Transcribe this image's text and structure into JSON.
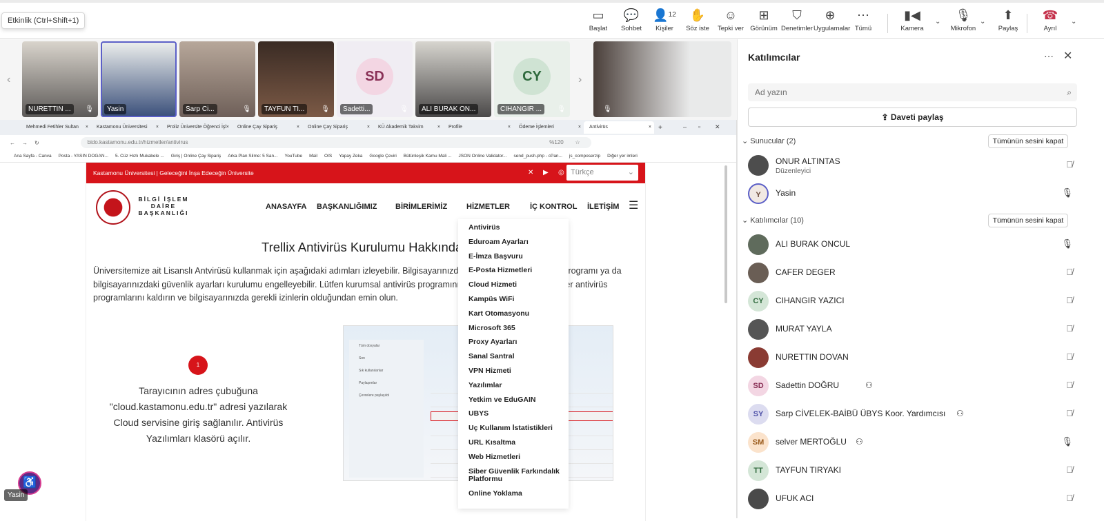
{
  "tooltip": "Etkinlik (Ctrl+Shift+1)",
  "toolbar": {
    "items": [
      {
        "label": "Başlat",
        "icon": "start-screen-icon"
      },
      {
        "label": "Sohbet",
        "icon": "chat-icon"
      },
      {
        "label": "Kişiler",
        "icon": "people-icon",
        "count": "12"
      },
      {
        "label": "Söz iste",
        "icon": "raise-hand-icon"
      },
      {
        "label": "Tepki ver",
        "icon": "reaction-icon"
      },
      {
        "label": "Görünüm",
        "icon": "view-icon"
      },
      {
        "label": "Denetimler",
        "icon": "controls-icon"
      },
      {
        "label": "Uygulamalar",
        "icon": "apps-icon"
      },
      {
        "label": "Tümü",
        "icon": "more-icon"
      },
      {
        "label": "Kamera",
        "icon": "camera-icon"
      },
      {
        "label": "Mikrofon",
        "icon": "mic-off-icon"
      },
      {
        "label": "Paylaş",
        "icon": "share-icon"
      },
      {
        "label": "Ayrıl",
        "icon": "hangup-icon"
      }
    ]
  },
  "gallery": {
    "tiles": [
      {
        "name": "NURETTIN ...",
        "type": "video"
      },
      {
        "name": "Yasin",
        "type": "video",
        "selected": true
      },
      {
        "name": "Sarp Ci...",
        "type": "video"
      },
      {
        "name": "TAYFUN TI...",
        "type": "video"
      },
      {
        "name": "Sadetti...",
        "type": "avatar",
        "initials": "SD"
      },
      {
        "name": "ALI BURAK ON...",
        "type": "video"
      },
      {
        "name": "CIHANGIR ...",
        "type": "avatar",
        "initials": "CY"
      }
    ]
  },
  "browser": {
    "tabs": [
      "Mehmedi Fetihler Sultan",
      "Kastamonu Üniversitesi",
      "Proliz Üniversite Öğrenci İşl",
      "Online Çay Sipariş",
      "Online Çay Sipariş",
      "KÜ Akademik Takvim",
      "Profile",
      "Ödeme İşlemleri",
      "Antivirüs"
    ],
    "url": "bido.kastamonu.edu.tr/hizmetler/antivirus",
    "zoom": "%120",
    "bookmarks": [
      "Ana Sayfa - Canva",
      "Posta - YASIN DOGAN...",
      "5. Cüz Hızlı Mukabele ...",
      "Giriş | Online Çay Sipariş",
      "Arka Plan Silme: 5 San...",
      "YouTube",
      "Mail",
      "OIS",
      "Yapay Zeka",
      "Google Çeviri",
      "Bütünleşik Kamu Mali ...",
      "JSON Online Validator...",
      "send_push.php - cPan...",
      "js_composerzip",
      "Diğer yer imleri"
    ]
  },
  "site": {
    "topbar_text": "Kastamonu Üniversitesi | Geleceğini İnşa Edeceğin Üniversite",
    "language": "Türkçe",
    "logo_text": "BİLGİ İŞLEM DAİRE BAŞKANLIĞI",
    "menu": [
      "ANASAYFA",
      "BAŞKANLIĞIMIZ",
      "BİRİMLERİMİZ",
      "HİZMETLER",
      "İÇ KONTROL",
      "İLETİŞİM"
    ],
    "title": "Trellix Antivirüs Kurulumu Hakkında",
    "paragraph": "Üniversitemize ait Lisanslı Antvirüsü kullanmak için aşağıdaki adımları izleyebilir. Bilgisayarınızda kurulu başka bir antivirüs programı ya da bilgisayarınızdaki güvenlik ayarları kurulumu engelleyebilir. Lütfen kurumsal antivirüs programını kurmadan önce mevcut diğer antivirüs programlarını kaldırın ve bilgisayarınızda gerekli izinlerin olduğundan emin olun.",
    "step_number": "1",
    "step_text": "Tarayıcının adres çubuğuna \"cloud.kastamonu.edu.tr\" adresi yazılarak Cloud servisine giriş sağlanılır. Antivirüs Yazılımları klasörü açılır.",
    "screenshot_side": [
      "Tüm dosyalar",
      "Son",
      "Sık kullanılanlar",
      "Paylaşımlar",
      "Çevrelere paylaşıldı"
    ],
    "dropdown": [
      "Antivirüs",
      "Eduroam Ayarları",
      "E-İmza Başvuru",
      "E-Posta Hizmetleri",
      "Cloud Hizmeti",
      "Kampüs WiFi",
      "Kart Otomasyonu",
      "Microsoft 365",
      "Proxy Ayarları",
      "Sanal Santral",
      "VPN Hizmeti",
      "Yazılımlar",
      "Yetkim ve EduGAIN",
      "UBYS",
      "Uç Kullanım İstatistikleri",
      "URL Kısaltma",
      "Web Hizmetleri",
      "Siber Güvenlik Farkındalık Platformu",
      "Online Yoklama"
    ]
  },
  "self_view_name": "Yasin",
  "panel": {
    "title": "Katılımcılar",
    "search_placeholder": "Ad yazın",
    "invite_label": "Daveti paylaş",
    "presenters_label": "Sunucular (2)",
    "attendees_label": "Katılımcılar (10)",
    "mute_all": "Tümünün sesini kapat",
    "presenters": [
      {
        "name": "ONUR ALTINTAS",
        "role": "Düzenleyici",
        "mic": "off"
      },
      {
        "name": "Yasin",
        "initials": "Y",
        "mic": "on"
      }
    ],
    "attendees": [
      {
        "name": "ALI BURAK ONCUL",
        "mic": "on"
      },
      {
        "name": "CAFER DEGER",
        "mic": "off"
      },
      {
        "name": "CIHANGIR YAZICI",
        "initials": "CY",
        "mic": "off"
      },
      {
        "name": "MURAT YAYLA",
        "mic": "off"
      },
      {
        "name": "NURETTIN DOVAN",
        "mic": "off"
      },
      {
        "name": "Sadettin DOĞRU",
        "initials": "SD",
        "mic": "off"
      },
      {
        "name": "Sarp CİVELEK-BAİBÜ ÜBYS Koor. Yardımcısı",
        "initials": "SY",
        "mic": "off"
      },
      {
        "name": "selver MERTOĞLU",
        "initials": "SM",
        "mic": "on"
      },
      {
        "name": "TAYFUN TIRYAKI",
        "initials": "TT",
        "mic": "off"
      },
      {
        "name": "UFUK ACI",
        "mic": "off"
      }
    ]
  }
}
